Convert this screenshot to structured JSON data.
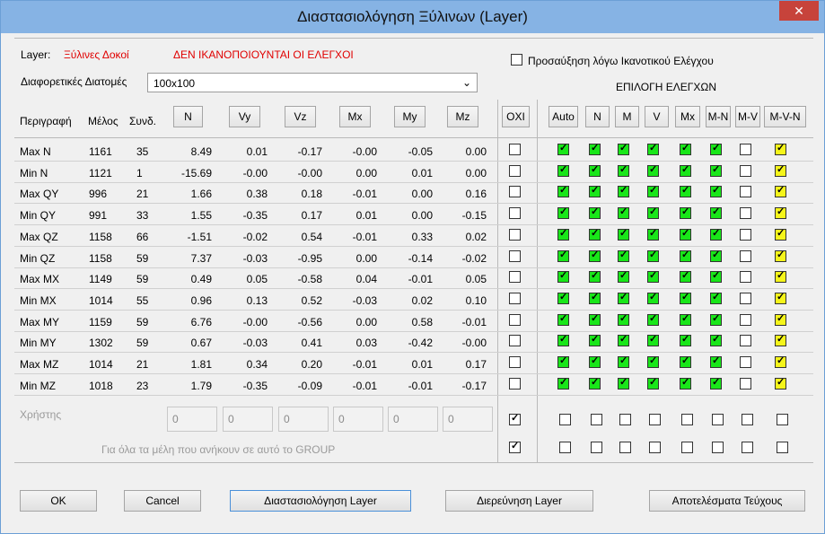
{
  "window": {
    "title": "Διαστασιολόγηση Ξύλινων (Layer)",
    "close_glyph": "✕"
  },
  "layer": {
    "label": "Layer:",
    "value": "Ξύλινες Δοκοί",
    "status": "ΔΕΝ ΙΚΑΝΟΠΟΙΟΥΝΤΑΙ ΟΙ ΕΛΕΓΧΟΙ"
  },
  "sections": {
    "label": "Διαφορετικές Διατομές",
    "selected": "100x100",
    "arrow": "⌄"
  },
  "capacity": {
    "label": "Προσαύξηση λόγω Ικανοτικού Ελέγχου",
    "checked": false
  },
  "checks_title": "ΕΠΙΛΟΓΗ ΕΛΕΓΧΩΝ",
  "headers": {
    "desc": "Περιγραφή",
    "member": "Μέλος",
    "combo": "Συνδ.",
    "forces": [
      "N",
      "Vy",
      "Vz",
      "Mx",
      "My",
      "Mz"
    ],
    "no": "ΟΧΙ",
    "checks": [
      "Auto",
      "N",
      "M",
      "V",
      "Mx",
      "M-N",
      "M-V",
      "M-V-N"
    ]
  },
  "rows": [
    {
      "desc": "Max N",
      "member": "1161",
      "combo": "35",
      "vals": [
        "8.49",
        "0.01",
        "-0.17",
        "-0.00",
        "-0.05",
        "0.00"
      ]
    },
    {
      "desc": "Min N",
      "member": "1121",
      "combo": "1",
      "vals": [
        "-15.69",
        "-0.00",
        "-0.00",
        "0.00",
        "0.01",
        "0.00"
      ]
    },
    {
      "desc": "Max QY",
      "member": "996",
      "combo": "21",
      "vals": [
        "1.66",
        "0.38",
        "0.18",
        "-0.01",
        "0.00",
        "0.16"
      ]
    },
    {
      "desc": "Min QY",
      "member": "991",
      "combo": "33",
      "vals": [
        "1.55",
        "-0.35",
        "0.17",
        "0.01",
        "0.00",
        "-0.15"
      ]
    },
    {
      "desc": "Max QZ",
      "member": "1158",
      "combo": "66",
      "vals": [
        "-1.51",
        "-0.02",
        "0.54",
        "-0.01",
        "0.33",
        "0.02"
      ]
    },
    {
      "desc": "Min QZ",
      "member": "1158",
      "combo": "59",
      "vals": [
        "7.37",
        "-0.03",
        "-0.95",
        "0.00",
        "-0.14",
        "-0.02"
      ]
    },
    {
      "desc": "Max MX",
      "member": "1149",
      "combo": "59",
      "vals": [
        "0.49",
        "0.05",
        "-0.58",
        "0.04",
        "-0.01",
        "0.05"
      ]
    },
    {
      "desc": "Min MX",
      "member": "1014",
      "combo": "55",
      "vals": [
        "0.96",
        "0.13",
        "0.52",
        "-0.03",
        "0.02",
        "0.10"
      ]
    },
    {
      "desc": "Max MY",
      "member": "1159",
      "combo": "59",
      "vals": [
        "6.76",
        "-0.00",
        "-0.56",
        "0.00",
        "0.58",
        "-0.01"
      ]
    },
    {
      "desc": "Min MY",
      "member": "1302",
      "combo": "59",
      "vals": [
        "0.67",
        "-0.03",
        "0.41",
        "0.03",
        "-0.42",
        "-0.00"
      ]
    },
    {
      "desc": "Max MZ",
      "member": "1014",
      "combo": "21",
      "vals": [
        "1.81",
        "0.34",
        "0.20",
        "-0.01",
        "0.01",
        "0.17"
      ]
    },
    {
      "desc": "Min MZ",
      "member": "1018",
      "combo": "23",
      "vals": [
        "1.79",
        "-0.35",
        "-0.09",
        "-0.01",
        "-0.01",
        "-0.17"
      ]
    }
  ],
  "row_checks": [
    true,
    true,
    true,
    true,
    true,
    true,
    false,
    true
  ],
  "user_row": {
    "label": "Χρήστης",
    "values": [
      "0",
      "0",
      "0",
      "0",
      "0",
      "0"
    ],
    "no_checked": true
  },
  "group_row": {
    "label": "Για όλα τα μέλη που ανήκουν σε αυτό το GROUP",
    "no_checked": true
  },
  "check_mark": "✓",
  "check_colors": {
    "on": "#19e619",
    "last": "#f5f51a",
    "off": "#ffffff"
  },
  "buttons": {
    "ok": "OK",
    "cancel": "Cancel",
    "design": "Διαστασιολόγηση Layer",
    "investigate": "Διερεύνηση Layer",
    "results": "Αποτελέσματα Τεύχους"
  }
}
